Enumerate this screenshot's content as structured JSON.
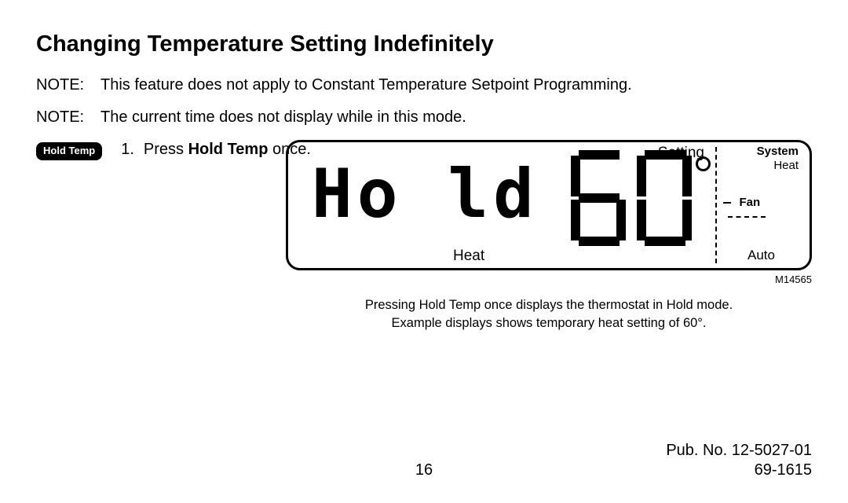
{
  "heading": "Changing Temperature Setting Indefinitely",
  "notes": [
    {
      "label": "NOTE:",
      "text": "This feature does not apply to Constant Temperature Setpoint Programming."
    },
    {
      "label": "NOTE:",
      "text": "The current time does not display while in this mode."
    }
  ],
  "pill_label": "Hold Temp",
  "step": {
    "number": "1.",
    "prefix": "Press ",
    "bold": "Hold Temp",
    "suffix": " once."
  },
  "lcd": {
    "hold_text": "Ho ld",
    "setting_label": "Setting",
    "temperature_value": 60,
    "main_mode": "Heat",
    "system_label": "System",
    "system_value": "Heat",
    "fan_label": "Fan",
    "fan_value": "Auto"
  },
  "figure_id": "M14565",
  "caption_line1": "Pressing Hold Temp once displays the thermostat in Hold mode.",
  "caption_line2": "Example displays shows temporary heat setting of 60°.",
  "pub_no": "Pub. No. 12-5027-01",
  "page_number": "16",
  "doc_number": "69-1615"
}
